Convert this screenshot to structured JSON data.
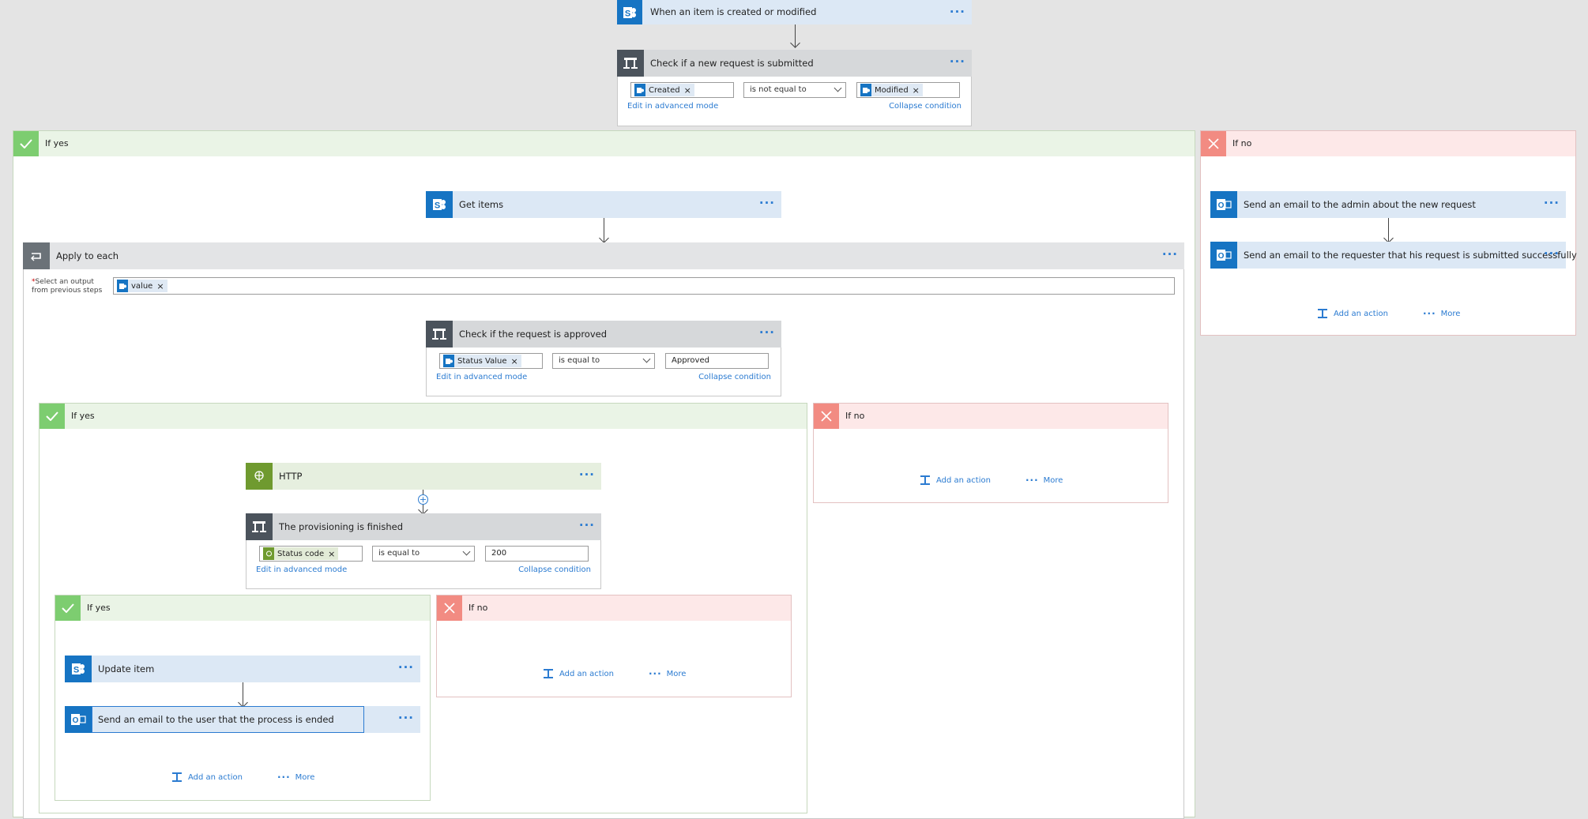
{
  "trigger": {
    "title": "When an item is created or modified",
    "more": "···"
  },
  "check_new": {
    "title": "Check if a new request is submitted",
    "more": "···",
    "left_token": "Created",
    "operator": "is not equal to",
    "right_token": "Modified",
    "advanced": "Edit in advanced mode",
    "collapse": "Collapse condition"
  },
  "outer_yes": {
    "label": "If yes"
  },
  "outer_no": {
    "label": "If no",
    "email_admin": "Send an email to the admin about the new request",
    "email_requester": "Send an email to the requester that his request is submitted successfully",
    "add_action": "Add an action",
    "more": "More"
  },
  "get_items": {
    "title": "Get items",
    "more": "···"
  },
  "apply_each": {
    "title": "Apply to each",
    "more": "···",
    "required": "*",
    "label_line1": "Select an output",
    "label_line2": "from previous steps",
    "token": "value"
  },
  "check_approved": {
    "title": "Check if the request is approved",
    "more": "···",
    "left_token": "Status Value",
    "operator": "is equal to",
    "value": "Approved",
    "advanced": "Edit in advanced mode",
    "collapse": "Collapse condition"
  },
  "approved_yes": {
    "label": "If yes"
  },
  "approved_no": {
    "label": "If no",
    "add_action": "Add an action",
    "more": "More"
  },
  "http": {
    "title": "HTTP",
    "more": "···"
  },
  "provisioning": {
    "title": "The provisioning is finished",
    "more": "···",
    "left_token": "Status code",
    "operator": "is equal to",
    "value": "200",
    "advanced": "Edit in advanced mode",
    "collapse": "Collapse condition"
  },
  "prov_yes": {
    "label": "If yes",
    "update_item": "Update item",
    "email_user": "Send an email to the user that the process is ended",
    "add_action": "Add an action",
    "more": "More"
  },
  "prov_no": {
    "label": "If no",
    "add_action": "Add an action",
    "more": "More"
  },
  "colors": {
    "accent": "#2b7bd1",
    "sharepoint": "#1674c3",
    "condition": "#4b535c",
    "http": "#6f9a2f",
    "yes": "#7dcd70",
    "no": "#f28b82"
  }
}
